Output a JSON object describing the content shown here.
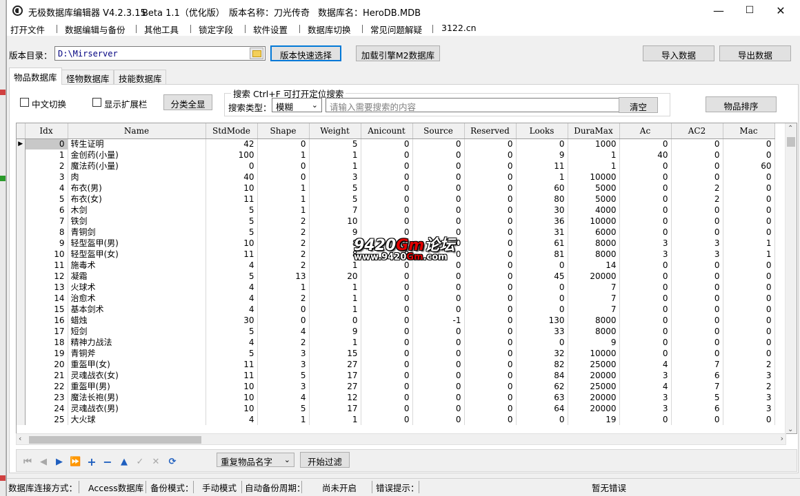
{
  "titlebar": {
    "title": "无极数据库编辑器 V4.2.3.15",
    "beta": "Beta 1.1（优化版）",
    "version_label": "版本名称：刀光传奇",
    "db_label": "数据库名：HeroDB.MDB",
    "minimize": "—",
    "maximize": "☐",
    "close": "✕"
  },
  "menu": [
    "打开文件",
    "数据编辑与备份",
    "其他工具",
    "锁定字段",
    "软件设置",
    "数据库切换",
    "常见问题解疑",
    "3122.cn"
  ],
  "toolbar": {
    "dir_label": "版本目录：",
    "dir_value": "D:\\Mirserver",
    "quick_select": "版本快速选择",
    "load_m2": "加载引擎M2数据库",
    "import": "导入数据",
    "export": "导出数据"
  },
  "tabs": [
    "物品数据库",
    "怪物数据库",
    "技能数据库"
  ],
  "filters": {
    "chinese_toggle": "中文切换",
    "show_ext": "显示扩展栏",
    "show_all": "分类全显",
    "search_title": "搜索   Ctrl+F 可打开定位搜索",
    "search_type_label": "搜索类型：",
    "search_type_value": "模糊",
    "search_placeholder": "请输入需要搜索的内容",
    "clear": "清空",
    "sort": "物品排序"
  },
  "grid": {
    "columns": [
      "Idx",
      "Name",
      "StdMode",
      "Shape",
      "Weight",
      "Anicount",
      "Source",
      "Reserved",
      "Looks",
      "DuraMax",
      "Ac",
      "AC2",
      "Mac"
    ],
    "rows": [
      [
        0,
        "转生证明",
        42,
        0,
        5,
        0,
        0,
        0,
        0,
        1000,
        0,
        0,
        0
      ],
      [
        1,
        "金创药(小量)",
        100,
        1,
        1,
        0,
        0,
        0,
        9,
        1,
        40,
        0,
        0
      ],
      [
        2,
        "魔法药(小量)",
        0,
        0,
        1,
        0,
        0,
        0,
        11,
        1,
        0,
        0,
        60
      ],
      [
        3,
        "肉",
        40,
        0,
        3,
        0,
        0,
        0,
        1,
        10000,
        0,
        0,
        0
      ],
      [
        4,
        "布衣(男)",
        10,
        1,
        5,
        0,
        0,
        0,
        60,
        5000,
        0,
        2,
        0
      ],
      [
        5,
        "布衣(女)",
        11,
        1,
        5,
        0,
        0,
        0,
        80,
        5000,
        0,
        2,
        0
      ],
      [
        6,
        "木剑",
        5,
        1,
        7,
        0,
        0,
        0,
        30,
        4000,
        0,
        0,
        0
      ],
      [
        7,
        "铁剑",
        5,
        2,
        10,
        0,
        0,
        0,
        36,
        10000,
        0,
        0,
        0
      ],
      [
        8,
        "青铜剑",
        5,
        2,
        9,
        0,
        0,
        0,
        31,
        6000,
        0,
        0,
        0
      ],
      [
        9,
        "轻型盔甲(男)",
        10,
        2,
        8,
        0,
        0,
        0,
        61,
        8000,
        3,
        3,
        1
      ],
      [
        10,
        "轻型盔甲(女)",
        11,
        2,
        8,
        0,
        0,
        0,
        81,
        8000,
        3,
        3,
        1
      ],
      [
        11,
        "施毒术",
        4,
        2,
        1,
        0,
        0,
        0,
        0,
        14,
        0,
        0,
        0
      ],
      [
        12,
        "凝霜",
        5,
        13,
        20,
        0,
        0,
        0,
        45,
        20000,
        0,
        0,
        0
      ],
      [
        13,
        "火球术",
        4,
        1,
        1,
        0,
        0,
        0,
        0,
        7,
        0,
        0,
        0
      ],
      [
        14,
        "治愈术",
        4,
        2,
        1,
        0,
        0,
        0,
        0,
        7,
        0,
        0,
        0
      ],
      [
        15,
        "基本剑术",
        4,
        0,
        1,
        0,
        0,
        0,
        0,
        7,
        0,
        0,
        0
      ],
      [
        16,
        "蜡烛",
        30,
        0,
        0,
        0,
        -1,
        0,
        130,
        8000,
        0,
        0,
        0
      ],
      [
        17,
        "短剑",
        5,
        4,
        9,
        0,
        0,
        0,
        33,
        8000,
        0,
        0,
        0
      ],
      [
        18,
        "精神力战法",
        4,
        2,
        1,
        0,
        0,
        0,
        0,
        9,
        0,
        0,
        0
      ],
      [
        19,
        "青铜斧",
        5,
        3,
        15,
        0,
        0,
        0,
        32,
        10000,
        0,
        0,
        0
      ],
      [
        20,
        "重盔甲(女)",
        11,
        3,
        27,
        0,
        0,
        0,
        82,
        25000,
        4,
        7,
        2
      ],
      [
        21,
        "灵魂战衣(女)",
        11,
        5,
        17,
        0,
        0,
        0,
        84,
        20000,
        3,
        6,
        3
      ],
      [
        22,
        "重盔甲(男)",
        10,
        3,
        27,
        0,
        0,
        0,
        62,
        25000,
        4,
        7,
        2
      ],
      [
        23,
        "魔法长袍(男)",
        10,
        4,
        12,
        0,
        0,
        0,
        63,
        20000,
        3,
        5,
        3
      ],
      [
        24,
        "灵魂战衣(男)",
        10,
        5,
        17,
        0,
        0,
        0,
        64,
        20000,
        3,
        6,
        3
      ],
      [
        25,
        "大火球",
        4,
        1,
        1,
        0,
        0,
        0,
        0,
        19,
        0,
        0,
        0
      ]
    ],
    "current_row_marker": "▶"
  },
  "watermark": {
    "line1_a": "9420",
    "line1_b": "Gm",
    "line1_c": "论坛",
    "line2_a": "www.9420",
    "line2_b": "Gm",
    "line2_c": ".com"
  },
  "navbar": {
    "icons": [
      "first-icon",
      "prior-icon",
      "next-icon",
      "last-icon",
      "insert-icon",
      "delete-icon",
      "edit-icon",
      "post-icon",
      "cancel-icon",
      "refresh-icon"
    ],
    "duplicate_select": "重复物品名字",
    "apply_filter": "开始过滤"
  },
  "statusbar": {
    "conn_label": "数据库连接方式：",
    "conn_value": "Access数据库",
    "backup_label": "备份模式：",
    "backup_value": "手动模式",
    "auto_label": "自动备份周期：",
    "auto_value": "尚未开启",
    "error_label": "错误提示：",
    "error_value": "暂无错误"
  },
  "colors": {
    "accent": "#0078d7",
    "selected_cell": "#c8c8c8",
    "nav_icon": "#1f5fbf",
    "watermark_red": "#e00000"
  }
}
